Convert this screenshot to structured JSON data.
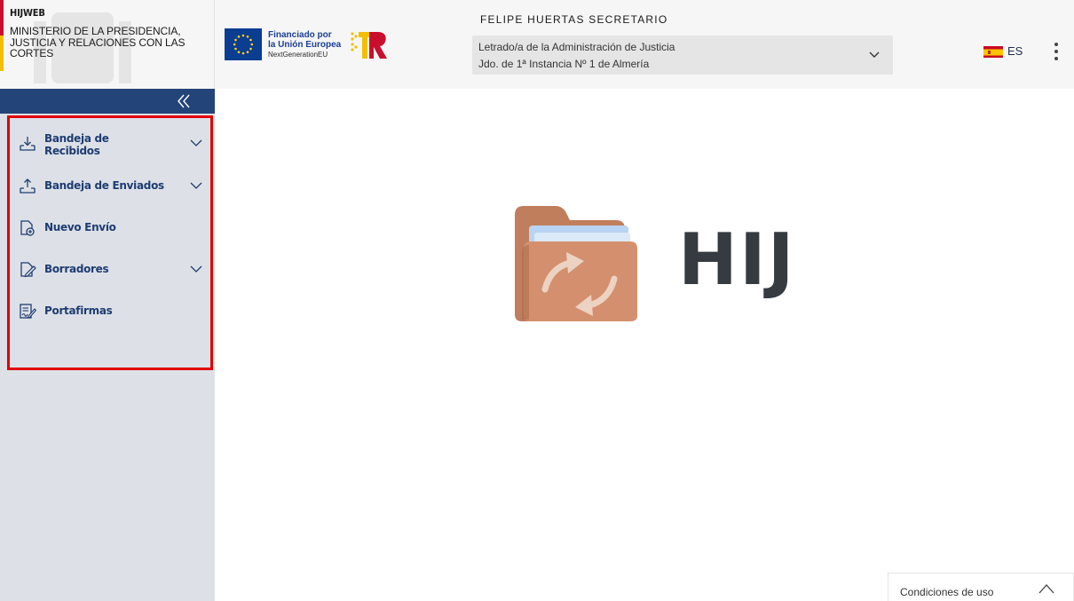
{
  "header": {
    "app_name": "HIJWEB",
    "ministry": "MINISTERIO DE LA PRESIDENCIA, JUSTICIA Y RELACIONES CON LAS CORTES",
    "funding": {
      "line1": "Financiado por",
      "line2": "la Unión Europea",
      "line3": "NextGenerationEU"
    },
    "user_name": "FELIPE HUERTAS SECRETARIO",
    "role_select": {
      "line1": "Letrado/a de la Administración de Justicia",
      "line2": "Jdo. de 1ª Instancia Nº 1 de Almería"
    },
    "language": "ES"
  },
  "sidebar": {
    "items": [
      {
        "label": "Bandeja de Recibidos",
        "icon": "inbox-download-icon",
        "expandable": true
      },
      {
        "label": "Bandeja de Enviados",
        "icon": "outbox-upload-icon",
        "expandable": true
      },
      {
        "label": "Nuevo Envío",
        "icon": "new-document-icon",
        "expandable": false
      },
      {
        "label": "Borradores",
        "icon": "draft-edit-icon",
        "expandable": true
      },
      {
        "label": "Portafirmas",
        "icon": "signature-document-icon",
        "expandable": false
      }
    ]
  },
  "main": {
    "title": "HIJ"
  },
  "footer": {
    "terms_label": "Condiciones de uso"
  },
  "colors": {
    "sidebar_bg": "#dde1e7",
    "collapse_bar": "#234478",
    "nav_text": "#1e3c72",
    "highlight_border": "#e00000",
    "folder": "#d4906e"
  }
}
